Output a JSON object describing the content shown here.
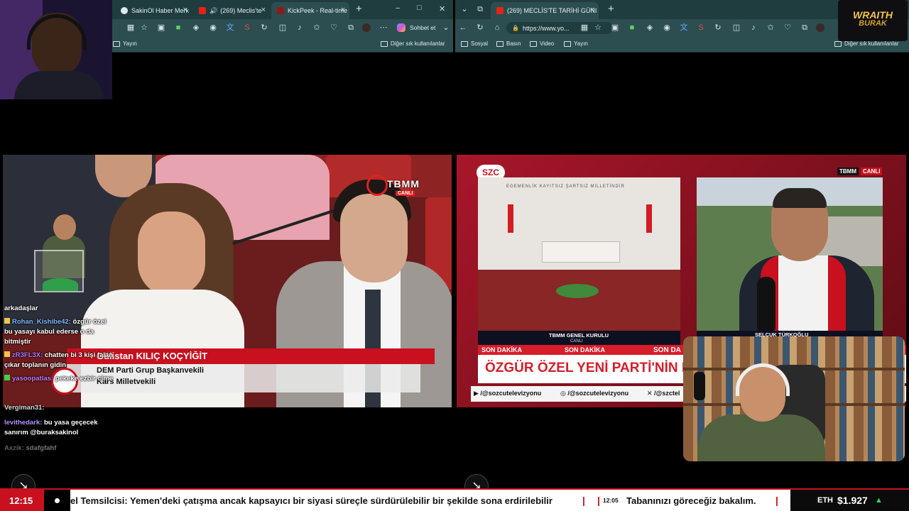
{
  "left_browser": {
    "tabs": [
      {
        "label": "SakinOl Haber Merk"
      },
      {
        "label": "(269) Meclis'te"
      },
      {
        "label": "KickPeek - Real-time"
      }
    ],
    "new_tab": "+",
    "window_controls": [
      "−",
      "□",
      "✕"
    ],
    "toolbar": {
      "chat_label": "Sohbet et"
    },
    "bookmarks": [
      {
        "label": "Yayın"
      }
    ],
    "other_bookmarks": "Diğer sık kullanılanlar"
  },
  "right_browser": {
    "tabs": [
      {
        "label": "(269) MECLİS'TE TARİHİ GÜNI Çer"
      }
    ],
    "new_tab": "+",
    "window_controls": [
      "−",
      "□",
      "✕"
    ],
    "url": "https://www.yo...",
    "bookmarks": [
      {
        "label": "Sosyal"
      },
      {
        "label": "Basın"
      },
      {
        "label": "Video"
      },
      {
        "label": "Yayın"
      }
    ],
    "other_bookmarks": "Diğer sık kullanılanlar"
  },
  "left_video": {
    "channel_logo": "TBMM",
    "channel_sub": "CANLI",
    "lower_third": {
      "name": "Gülistan KILIÇ KOÇYİĞİT",
      "title": "DEM Parti Grup Başkanvekili",
      "subtitle": "Kars Milletvekili"
    }
  },
  "right_video": {
    "channel": "SZC",
    "live_badge_left": "TBMM",
    "live_badge_right": "CANLI",
    "assembly_caption": "TBMM GENEL KURULU",
    "assembly_caption_sub": "CANLI",
    "hall_motto": "EGEMENLİK KAYITSIZ ŞARTSIZ MİLLETİNDİR",
    "guest_name": "SELÇUK TÜRKOĞLU",
    "breaking_labels": [
      "SON DAKİKA",
      "SON DAKİKA",
      "SON DA"
    ],
    "headline": "ÖZGÜR ÖZEL YENİ PARTİ'NİN KA",
    "socials": [
      "/@sozcutelevizyonu",
      "/@sozcutelevizyonu",
      "/@szctel"
    ]
  },
  "chat": [
    {
      "user": "",
      "text": "arkadaşlar"
    },
    {
      "user": "Rohan_Kishibe42:",
      "text": "özgür özel"
    },
    {
      "user": "",
      "text": "bu yasayı kabul ederse o da"
    },
    {
      "user": "",
      "text": "bitmiştir"
    },
    {
      "user": "zR3FL3X:",
      "text": "chatten bi 3 kişi falan"
    },
    {
      "user": "",
      "text": "çıkar toplanın gidin"
    },
    {
      "user": "yasoopatlas:",
      "text": "pekeke ezbir cime"
    },
    {
      "user": "Vergiman31:",
      "text": ""
    },
    {
      "user": "levithedark:",
      "text": "bu yasa geçecek"
    },
    {
      "user": "",
      "text": "sanırım @buraksakinol"
    },
    {
      "user": "Axzik:",
      "text": "sdafgfahf"
    }
  ],
  "logo": {
    "line1": "WRAITH",
    "line2": "BURAK"
  },
  "ticker": {
    "time": "12:15",
    "text1": "el Temsilcisi: Yemen'deki çatışma ancak kapsayıcı bir siyasi süreçle sürdürülebilir bir şekilde sona erdirilebilir",
    "sep": "|",
    "time2": "12:05",
    "text2": "Tabanınızı göreceğiz bakalım.",
    "crypto_label": "ETH",
    "crypto_value": "$1.927",
    "crypto_arrow": "▲"
  },
  "colors": {
    "accent_red": "#c8101e",
    "browser_bg": "#2c4e51",
    "tab_bg": "#1f3d3f",
    "chat_user": "#7fb8ff",
    "eth_up": "#3ad24c"
  }
}
